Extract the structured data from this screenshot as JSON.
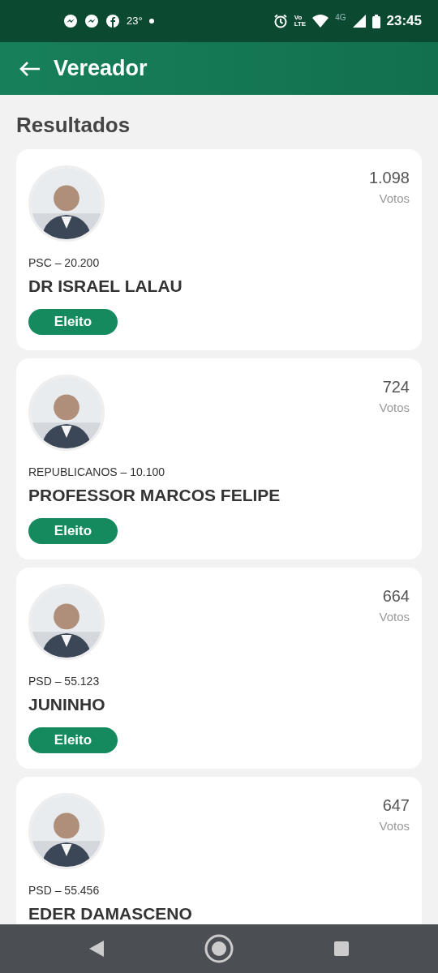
{
  "status_bar": {
    "temperature": "23°",
    "volte_top": "Vo",
    "volte_bottom": "LTE",
    "network": "4G",
    "time": "23:45"
  },
  "app_bar": {
    "title": "Vereador"
  },
  "section_title": "Resultados",
  "candidates": [
    {
      "party": "PSC – 20.200",
      "name": "DR ISRAEL LALAU",
      "votes": "1.098",
      "votes_label": "Votos",
      "status": "Eleito"
    },
    {
      "party": "REPUBLICANOS – 10.100",
      "name": "PROFESSOR MARCOS FELIPE",
      "votes": "724",
      "votes_label": "Votos",
      "status": "Eleito"
    },
    {
      "party": "PSD – 55.123",
      "name": "JUNINHO",
      "votes": "664",
      "votes_label": "Votos",
      "status": "Eleito"
    },
    {
      "party": "PSD – 55.456",
      "name": "EDER DAMASCENO",
      "votes": "647",
      "votes_label": "Votos"
    }
  ]
}
